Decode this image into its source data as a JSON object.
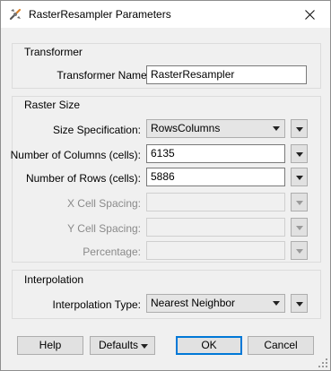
{
  "window": {
    "title": "RasterResampler Parameters"
  },
  "transformer": {
    "group_title": "Transformer",
    "name_label": "Transformer Name:",
    "name_value": "RasterResampler"
  },
  "raster_size": {
    "group_title": "Raster Size",
    "size_spec_label": "Size Specification:",
    "size_spec_value": "RowsColumns",
    "columns_label": "Number of Columns (cells):",
    "columns_value": "6135",
    "rows_label": "Number of Rows (cells):",
    "rows_value": "5886",
    "x_spacing_label": "X Cell Spacing:",
    "x_spacing_value": "",
    "y_spacing_label": "Y Cell Spacing:",
    "y_spacing_value": "",
    "percentage_label": "Percentage:",
    "percentage_value": ""
  },
  "interpolation": {
    "group_title": "Interpolation",
    "type_label": "Interpolation Type:",
    "type_value": "Nearest Neighbor"
  },
  "footer": {
    "help_label": "Help",
    "defaults_label": "Defaults",
    "ok_label": "OK",
    "cancel_label": "Cancel"
  }
}
